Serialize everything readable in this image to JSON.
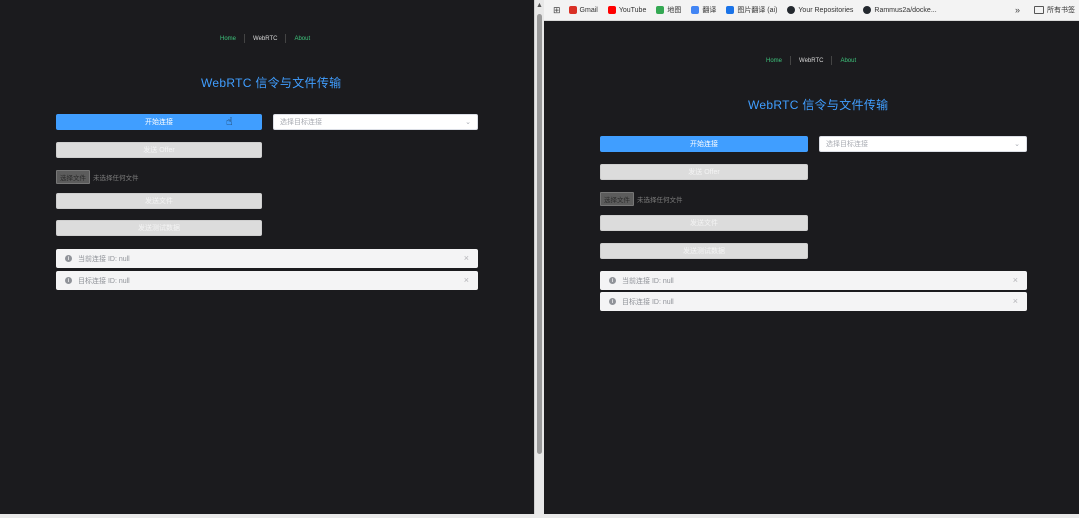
{
  "bookmarks": {
    "items": [
      {
        "label": "Gmail",
        "color": "#d93025"
      },
      {
        "label": "YouTube",
        "color": "#ff0000"
      },
      {
        "label": "地图",
        "color": "#34a853"
      },
      {
        "label": "翻译",
        "color": "#4285f4"
      },
      {
        "label": "图片翻译 (ai)",
        "color": "#1a73e8"
      },
      {
        "label": "Your Repositories",
        "color": "#24292f"
      },
      {
        "label": "Rammus2a/docke...",
        "color": "#24292f"
      }
    ],
    "overflow": "»",
    "folder_label": "所有书签"
  },
  "nav": {
    "home": "Home",
    "webrtc": "WebRTC",
    "about": "About"
  },
  "page": {
    "title": "WebRTC 信令与文件传输",
    "start_button": "开始连接",
    "select_placeholder": "选择目标连接",
    "send_offer_button": "发送 Offer",
    "choose_file_button": "选择文件",
    "no_file_text": "未选择任何文件",
    "send_file_button": "发送文件",
    "send_test_button": "发送测试数据",
    "current_id_text": "当前连接 ID: null",
    "target_id_text": "目标连接 ID: null"
  },
  "icons": {
    "select_arrow": "chevron-down-icon",
    "alert": "info-icon",
    "close": "close-icon"
  },
  "colors": {
    "accent": "#409eff",
    "nav_link": "#3ec47c",
    "background": "#1b1b1e",
    "alert_bg": "#f4f4f5"
  }
}
